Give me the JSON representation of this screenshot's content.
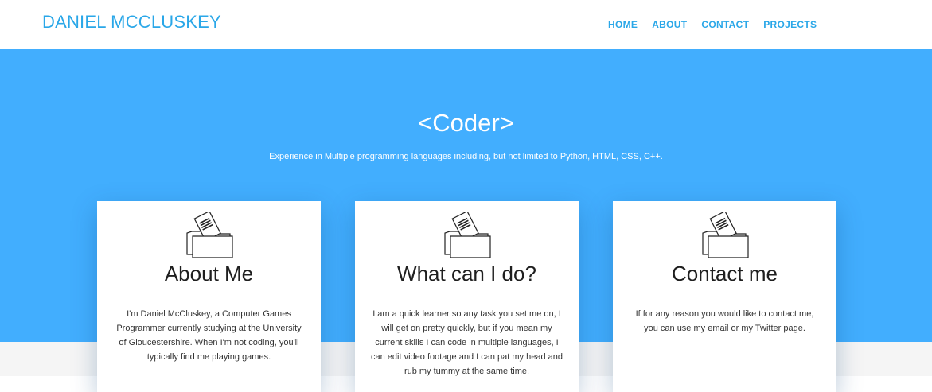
{
  "nav": {
    "brand": "DANIEL MCCLUSKEY",
    "links": [
      "HOME",
      "ABOUT",
      "CONTACT",
      "PROJECTS"
    ]
  },
  "hero": {
    "title": "<Coder>",
    "subtitle": "Experience in Multiple programming languages including, but not limited to Python, HTML, CSS, C++."
  },
  "cards": [
    {
      "icon": "folder-document-icon",
      "title": "About Me",
      "text": "I'm Daniel McCluskey, a Computer Games Programmer currently studying at the University of Gloucestershire. When I'm not coding, you'll typically find me playing games."
    },
    {
      "icon": "folder-document-icon",
      "title": "What can I do?",
      "text": "I am a quick learner so any task you set me on, I will get on pretty quickly, but if you mean my current skills I can code in multiple languages, I can edit video footage and I can pat my head and rub my tummy at the same time."
    },
    {
      "icon": "folder-document-icon",
      "title": "Contact me",
      "text": "If for any reason you would like to contact me, you can use my email or my Twitter page."
    }
  ],
  "colors": {
    "accent": "#2aa7e8",
    "hero_bg": "#42aefe",
    "card_bg": "#ffffff",
    "footer_bg": "#f5f5f5"
  }
}
